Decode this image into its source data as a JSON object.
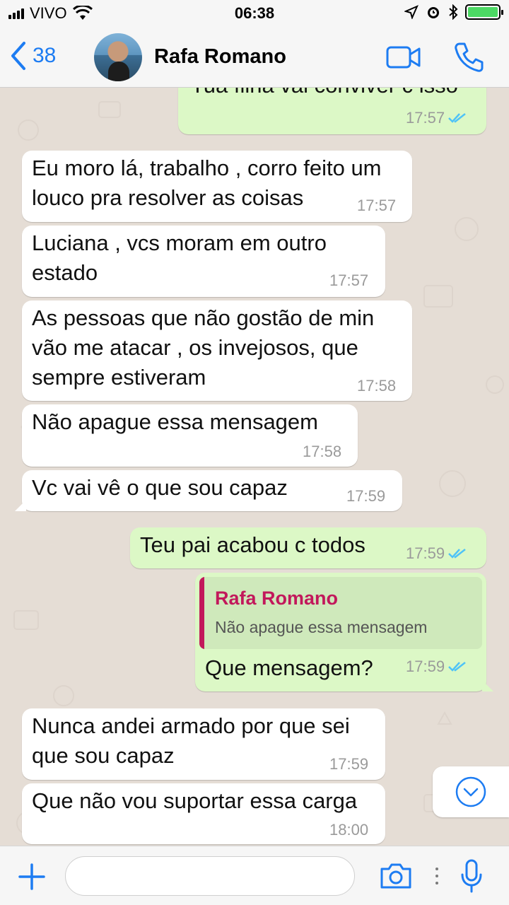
{
  "status_bar": {
    "carrier": "VIVO",
    "time": "06:38"
  },
  "header": {
    "back_count": "38",
    "contact_name": "Rafa Romano"
  },
  "messages": [
    {
      "direction": "out",
      "text": "Tua filha vai conviver c isso",
      "time": "17:57",
      "read": true
    },
    {
      "direction": "in",
      "lines": [
        "Eu moro lá, trabalho , corro feito um",
        "louco pra resolver as coisas"
      ],
      "time": "17:57"
    },
    {
      "direction": "in",
      "lines": [
        "Luciana , vcs moram em outro",
        "estado"
      ],
      "time": "17:57"
    },
    {
      "direction": "in",
      "lines": [
        "As pessoas que não gostão de min",
        "vão me atacar , os invejosos, que",
        "sempre estiveram"
      ],
      "time": "17:58"
    },
    {
      "direction": "in",
      "text": "Não apague essa mensagem",
      "time": "17:58"
    },
    {
      "direction": "in",
      "text": "Vc vai vê o que sou capaz",
      "time": "17:59"
    },
    {
      "direction": "out",
      "text": "Teu pai acabou c todos",
      "time": "17:59",
      "read": true
    },
    {
      "direction": "out",
      "quote_author": "Rafa Romano",
      "quote_text": "Não apague essa mensagem",
      "text": "Que mensagem?",
      "time": "17:59",
      "read": true
    },
    {
      "direction": "in",
      "lines": [
        "Nunca andei armado por que sei",
        "que sou capaz"
      ],
      "time": "17:59"
    },
    {
      "direction": "in",
      "text": "Que não vou suportar essa carga",
      "time": "18:00"
    }
  ],
  "input": {
    "placeholder": ""
  },
  "colors": {
    "accent": "#1d7cf2",
    "outgoing_bubble": "#dcf8c6",
    "incoming_bubble": "#ffffff",
    "chat_background": "#e5ddd5",
    "quote_author": "#c2185b",
    "battery": "#4cd964",
    "read_ticks": "#4fc3f7"
  },
  "icons": {
    "back": "chevron-left-icon",
    "video_call": "video-camera-icon",
    "voice_call": "phone-icon",
    "attach": "plus-icon",
    "camera": "camera-icon",
    "microphone": "microphone-icon",
    "scroll_down": "chevron-down-circle-icon"
  }
}
